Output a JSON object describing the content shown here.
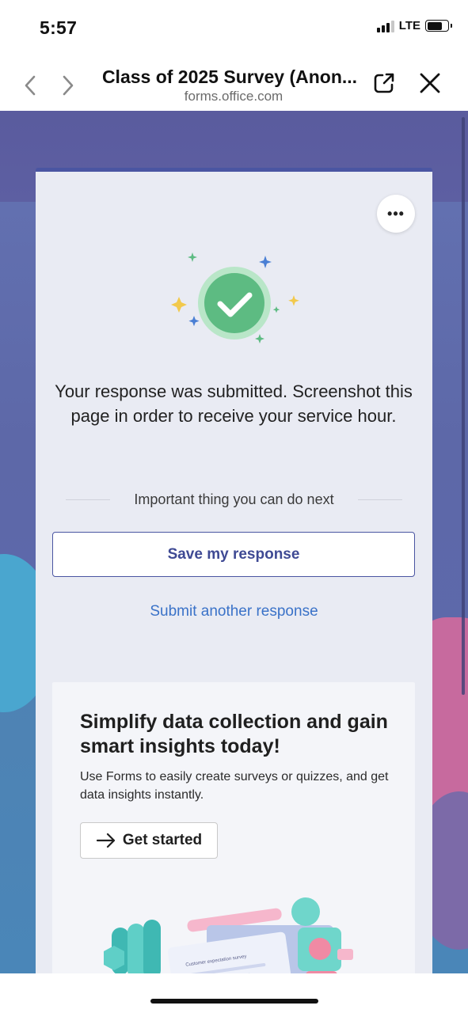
{
  "status_bar": {
    "time": "5:57",
    "network": "LTE"
  },
  "browser": {
    "title": "Class of 2025 Survey (Anon...",
    "url": "forms.office.com",
    "back_icon": "chevron-left-icon",
    "forward_icon": "chevron-right-icon",
    "share_icon": "open-external-icon",
    "close_icon": "close-icon"
  },
  "form": {
    "more_label": "•••",
    "success_icon": "check-circle-icon",
    "message": "Your response was submitted. Screenshot this page in order to receive your service hour.",
    "next_heading": "Important thing you can do next",
    "save_button": "Save my response",
    "another_link": "Submit another response"
  },
  "promo": {
    "title": "Simplify data collection and gain smart insights today!",
    "description": "Use Forms to easily create surveys or quizzes, and get data insights instantly.",
    "cta_label": "Get started",
    "cta_icon": "arrow-right-icon",
    "art_survey_title": "Customer expectation survey"
  },
  "colors": {
    "accent": "#4a55a2",
    "link": "#3a72c8",
    "check_green": "#5dbb82"
  }
}
